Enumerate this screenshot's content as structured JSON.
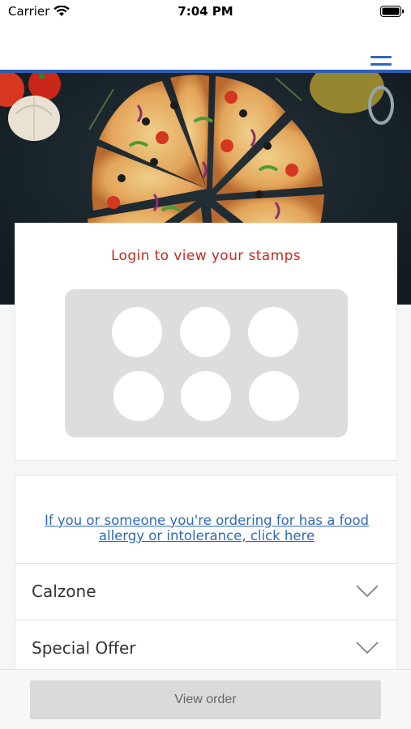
{
  "status_bar": {
    "carrier": "Carrier",
    "time": "7:04 PM",
    "wifi_icon": "wifi-icon",
    "battery_icon": "battery-icon"
  },
  "header": {
    "menu_icon": "hamburger-menu-icon",
    "accent_color": "#2f5fb3"
  },
  "hero": {
    "image": "pizza-photo"
  },
  "stamps": {
    "title": "Login to view your stamps",
    "title_color": "#c42a1f",
    "stamp_count": 6
  },
  "allergy": {
    "link_text": "If you or someone you're ordering for has a food allergy or intolerance, click here",
    "link_color": "#2f6ab8"
  },
  "menu": {
    "categories": [
      {
        "label": "Calzone",
        "icon": "chevron-down-icon"
      },
      {
        "label": "Special Offer",
        "icon": "chevron-down-icon"
      }
    ]
  },
  "footer": {
    "view_order_label": "View order"
  }
}
